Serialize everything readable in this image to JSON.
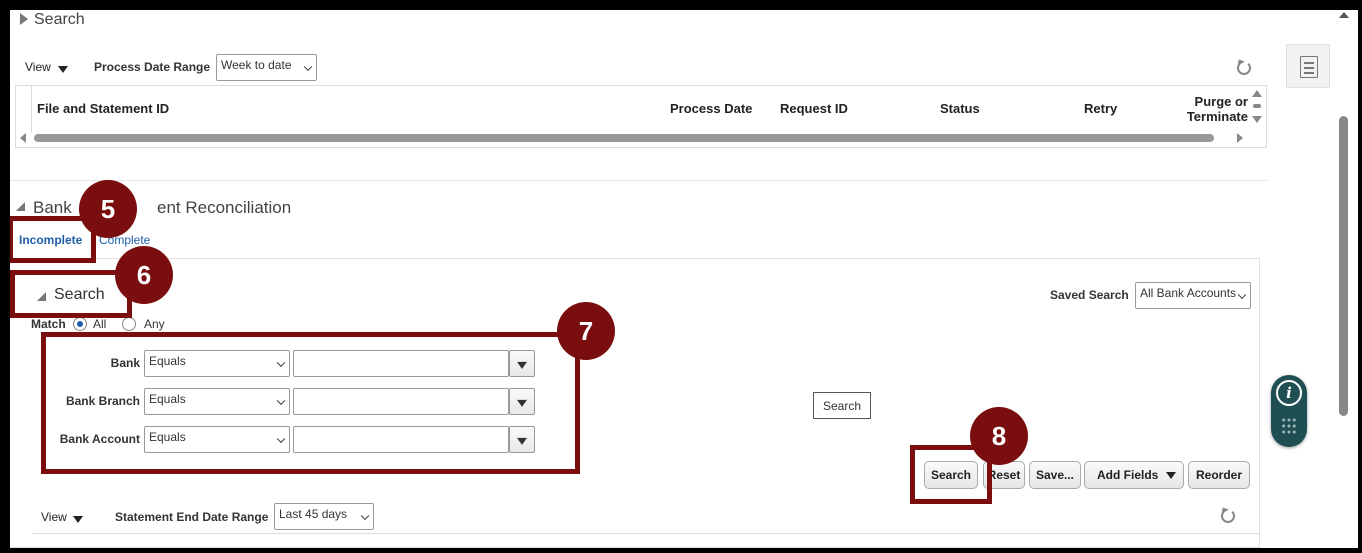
{
  "top_section": {
    "title": "Search",
    "view_label": "View",
    "date_range_label": "Process Date Range",
    "date_range_value": "Week to date",
    "columns": [
      "File and Statement ID",
      "Process Date",
      "Request ID",
      "Status",
      "Retry",
      "Purge or Terminate"
    ]
  },
  "reconciliation": {
    "title_visible": "Bank",
    "title_tail": "ent Reconciliation",
    "tabs": {
      "incomplete": "Incomplete",
      "complete": "Complete"
    },
    "search_title": "Search",
    "saved_search_label": "Saved Search",
    "saved_search_value": "All Bank Accounts",
    "match_label": "Match",
    "match_all": "All",
    "match_any": "Any",
    "fields": [
      {
        "label": "Bank",
        "operator": "Equals"
      },
      {
        "label": "Bank Branch",
        "operator": "Equals"
      },
      {
        "label": "Bank Account",
        "operator": "Equals"
      }
    ],
    "tooltip_search": "Search",
    "buttons": {
      "search": "Search",
      "reset": "Reset",
      "save": "Save...",
      "add_fields": "Add Fields",
      "reorder": "Reorder"
    },
    "view_label": "View",
    "end_date_label": "Statement End Date Range",
    "end_date_value": "Last 45 days"
  },
  "callouts": {
    "c5": "5",
    "c6": "6",
    "c7": "7",
    "c8": "8"
  },
  "colors": {
    "callout": "#7a0d0d",
    "link": "#1e5fa8",
    "help_button": "#1f4e53"
  }
}
